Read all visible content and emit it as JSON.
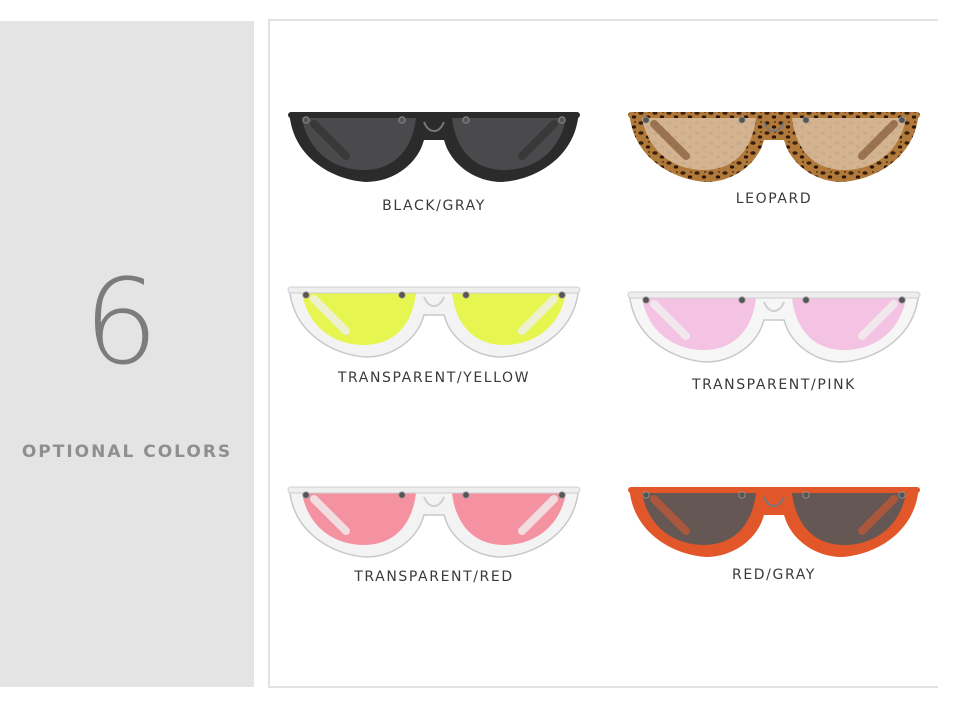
{
  "panel": {
    "number": "6",
    "label": "OPTIONAL COLORS"
  },
  "items": [
    {
      "label": "BLACK/GRAY",
      "frame_color": "#2b2b2b",
      "lens_color": "#4d4d4f",
      "pattern": "solid"
    },
    {
      "label": "LEOPARD",
      "frame_color": "#6b3e1c",
      "lens_color": "#d7b898",
      "pattern": "leopard"
    },
    {
      "label": "TRANSPARENT/YELLOW",
      "frame_color": "#dcdcdc",
      "lens_color": "#e6f542",
      "pattern": "clear"
    },
    {
      "label": "TRANSPARENT/PINK",
      "frame_color": "#e4e4e4",
      "lens_color": "#f3bde0",
      "pattern": "clear"
    },
    {
      "label": "TRANSPARENT/RED",
      "frame_color": "#dcdcdc",
      "lens_color": "#f58a9a",
      "pattern": "clear"
    },
    {
      "label": "RED/GRAY",
      "frame_color": "#e2572a",
      "lens_color": "#5a5858",
      "pattern": "solid"
    }
  ]
}
